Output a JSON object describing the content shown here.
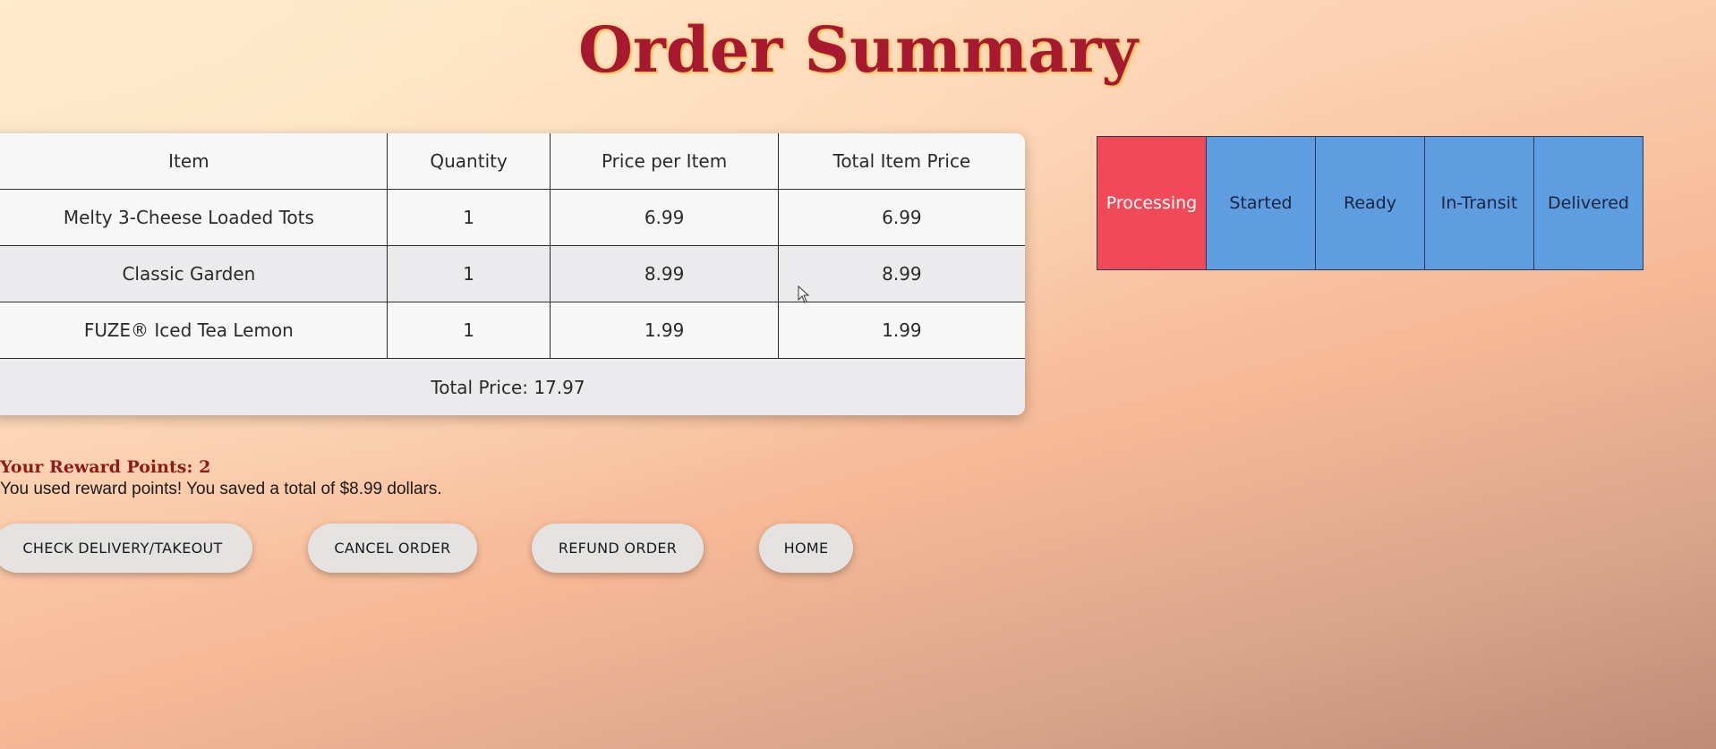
{
  "page": {
    "title": "Order Summary"
  },
  "order_table": {
    "headers": [
      "Item",
      "Quantity",
      "Price per Item",
      "Total Item Price"
    ],
    "rows": [
      {
        "item": "Melty 3-Cheese Loaded Tots",
        "quantity": "1",
        "price": "6.99",
        "total": "6.99"
      },
      {
        "item": "Classic Garden",
        "quantity": "1",
        "price": "8.99",
        "total": "8.99"
      },
      {
        "item": "FUZE® Iced Tea Lemon",
        "quantity": "1",
        "price": "1.99",
        "total": "1.99"
      }
    ],
    "total_price": "Total Price: 17.97"
  },
  "order_status": {
    "steps": [
      "Processing",
      "Started",
      "Ready",
      "In-Transit",
      "Delivered"
    ],
    "active_step": "Processing",
    "active_color": "#f04a58",
    "inactive_color": "#5e9ee0"
  },
  "rewards": {
    "title": "Your Reward Points: 2",
    "note": "You used reward points! You saved a total of $8.99 dollars."
  },
  "actions": {
    "check_delivery": "CHECK DELIVERY/TAKEOUT",
    "cancel_order": "CANCEL ORDER",
    "refund_order": "REFUND ORDER",
    "home": "HOME"
  },
  "colors": {
    "title": "#a6192e",
    "title_glow": "#f5c35a"
  }
}
